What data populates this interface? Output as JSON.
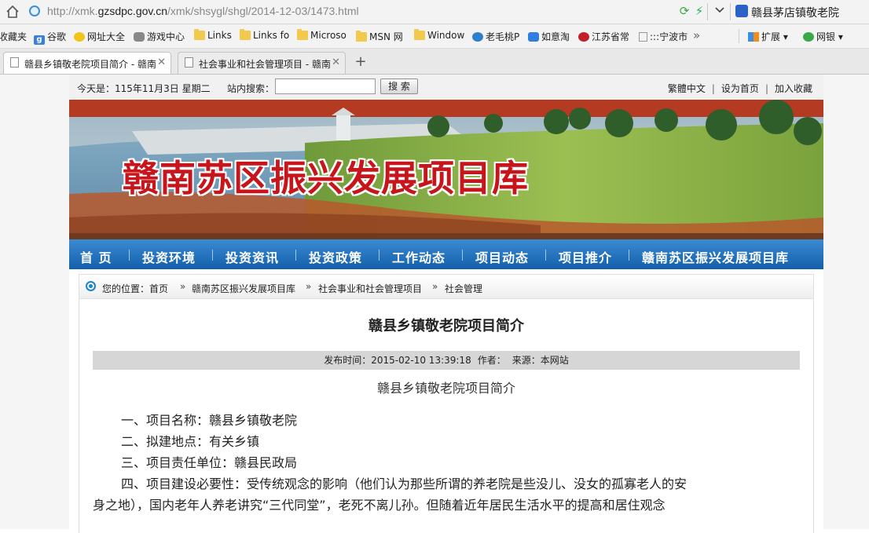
{
  "browser": {
    "url_prefix": "http://xmk.",
    "url_domain": "gzsdpc.gov.cn",
    "url_path": "/xmk/shsygl/shgl/2014-12-03/1473.html",
    "search_text": "赣县茅店镇敬老院",
    "favorites": [
      {
        "label": "收藏夹",
        "icon": "star-icon"
      },
      {
        "label": "谷歌",
        "icon": "google-icon"
      },
      {
        "label": "网址大全",
        "icon": "nav-plus-icon"
      },
      {
        "label": "游戏中心",
        "icon": "gamepad-icon"
      },
      {
        "label": "Links",
        "icon": "folder-icon"
      },
      {
        "label": "Links fo",
        "icon": "folder-icon"
      },
      {
        "label": "Microso",
        "icon": "folder-icon"
      },
      {
        "label": "MSN 网",
        "icon": "folder-icon"
      },
      {
        "label": "Window",
        "icon": "folder-icon"
      },
      {
        "label": "老毛桃P",
        "icon": "globe-icon"
      },
      {
        "label": "如意淘",
        "icon": "shield-icon"
      },
      {
        "label": "江苏省常",
        "icon": "red-seal-icon"
      },
      {
        "label": ":::宁波市",
        "icon": "page-icon"
      }
    ],
    "ext_label": "扩展",
    "bank_label": "网银",
    "tabs": [
      {
        "label": "赣县乡镇敬老院项目简介 - 赣南",
        "active": true
      },
      {
        "label": "社会事业和社会管理项目 - 赣南",
        "active": false
      }
    ]
  },
  "topbar": {
    "today": "今天是：115年11月3日 星期二",
    "search_label": "站内搜索：",
    "search_value": "",
    "search_button": "搜 索",
    "traditional": "繁體中文",
    "set_home": "设为首页",
    "add_fav": "加入收藏"
  },
  "banner": {
    "title": "赣南苏区振兴发展项目库"
  },
  "nav": [
    "首 页",
    "投资环境",
    "投资资讯",
    "投资政策",
    "工作动态",
    "项目动态",
    "项目推介",
    "赣南苏区振兴发展项目库"
  ],
  "breadcrumb": {
    "prefix": "您的位置：首页",
    "items": [
      "赣南苏区振兴发展项目库",
      "社会事业和社会管理项目",
      "社会管理"
    ]
  },
  "article": {
    "title": "赣县乡镇敬老院项目简介",
    "publish_time": "发布时间：2015-02-10 13:39:18",
    "author": "作者：",
    "source": "来源：本网站",
    "subtitle": "赣县乡镇敬老院项目简介",
    "paragraphs": [
      "一、项目名称：赣县乡镇敬老院",
      "二、拟建地点：有关乡镇",
      "三、项目责任单位：赣县民政局",
      "四、项目建设必要性：受传统观念的影响（他们认为那些所谓的养老院是些没儿、没女的孤寡老人的安",
      "身之地），国内老年人养老讲究“三代同堂”，老死不离儿孙。但随着近年居民生活水平的提高和居住观念"
    ]
  },
  "colors": {
    "nav_top": "#3b8bd3",
    "nav_bottom": "#135fab",
    "banner_title": "#c8141b",
    "meta_bg": "#d6d6d6"
  }
}
